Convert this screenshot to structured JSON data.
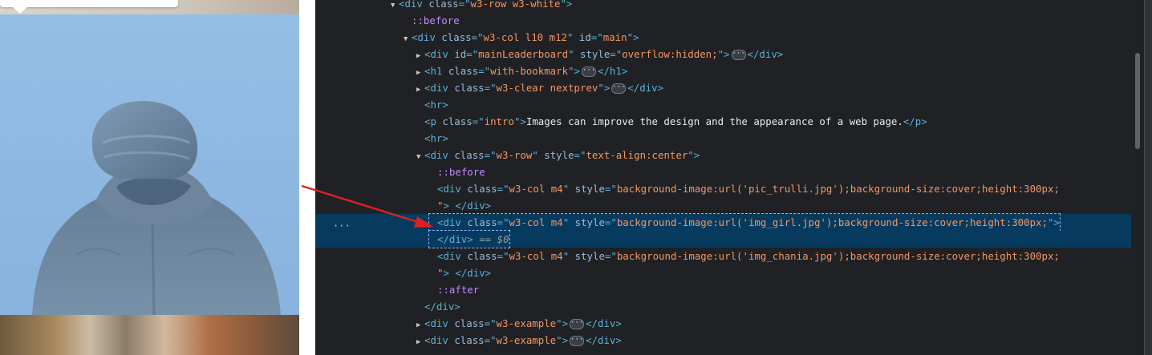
{
  "preview": {
    "images": [
      "pic_trulli.jpg",
      "img_girl.jpg",
      "img_chania.jpg"
    ]
  },
  "gutter": {
    "more_label": "···"
  },
  "elements_tree": [
    {
      "indent": 0,
      "tri": "open",
      "parts": [
        [
          "tag",
          "<div "
        ],
        [
          "attr",
          "class"
        ],
        [
          "tag",
          "=\""
        ],
        [
          "val",
          "w3-row w3-white"
        ],
        [
          "tag",
          "\">"
        ]
      ]
    },
    {
      "indent": 1,
      "tri": "",
      "parts": [
        [
          "pseudo",
          "::before"
        ]
      ]
    },
    {
      "indent": 1,
      "tri": "open",
      "parts": [
        [
          "tag",
          "<div "
        ],
        [
          "attr",
          "class"
        ],
        [
          "tag",
          "=\""
        ],
        [
          "val",
          "w3-col l10 m12"
        ],
        [
          "tag",
          "\" "
        ],
        [
          "attr",
          "id"
        ],
        [
          "tag",
          "=\""
        ],
        [
          "val",
          "main"
        ],
        [
          "tag",
          "\">"
        ]
      ]
    },
    {
      "indent": 2,
      "tri": "closed",
      "parts": [
        [
          "tag",
          "<div "
        ],
        [
          "attr",
          "id"
        ],
        [
          "tag",
          "=\""
        ],
        [
          "val",
          "mainLeaderboard"
        ],
        [
          "tag",
          "\" "
        ],
        [
          "attr",
          "style"
        ],
        [
          "tag",
          "=\""
        ],
        [
          "val",
          "overflow:hidden;"
        ],
        [
          "tag",
          "\">"
        ],
        [
          "ell",
          "···"
        ],
        [
          "tag",
          "</div>"
        ]
      ]
    },
    {
      "indent": 2,
      "tri": "closed",
      "parts": [
        [
          "tag",
          "<h1 "
        ],
        [
          "attr",
          "class"
        ],
        [
          "tag",
          "=\""
        ],
        [
          "val",
          "with-bookmark"
        ],
        [
          "tag",
          "\">"
        ],
        [
          "ell",
          "···"
        ],
        [
          "tag",
          "</h1>"
        ]
      ]
    },
    {
      "indent": 2,
      "tri": "closed",
      "parts": [
        [
          "tag",
          "<div "
        ],
        [
          "attr",
          "class"
        ],
        [
          "tag",
          "=\""
        ],
        [
          "val",
          "w3-clear nextprev"
        ],
        [
          "tag",
          "\">"
        ],
        [
          "ell",
          "···"
        ],
        [
          "tag",
          "</div>"
        ]
      ]
    },
    {
      "indent": 2,
      "tri": "",
      "parts": [
        [
          "tag",
          "<hr>"
        ]
      ]
    },
    {
      "indent": 2,
      "tri": "",
      "parts": [
        [
          "tag",
          "<p "
        ],
        [
          "attr",
          "class"
        ],
        [
          "tag",
          "=\""
        ],
        [
          "val",
          "intro"
        ],
        [
          "tag",
          "\">"
        ],
        [
          "text",
          "Images can improve the design and the appearance of a web page."
        ],
        [
          "tag",
          "</p>"
        ]
      ]
    },
    {
      "indent": 2,
      "tri": "",
      "parts": [
        [
          "tag",
          "<hr>"
        ]
      ]
    },
    {
      "indent": 2,
      "tri": "open",
      "parts": [
        [
          "tag",
          "<div "
        ],
        [
          "attr",
          "class"
        ],
        [
          "tag",
          "=\""
        ],
        [
          "val",
          "w3-row"
        ],
        [
          "tag",
          "\" "
        ],
        [
          "attr",
          "style"
        ],
        [
          "tag",
          "=\""
        ],
        [
          "val",
          "text-align:center"
        ],
        [
          "tag",
          "\">"
        ]
      ]
    },
    {
      "indent": 3,
      "tri": "",
      "parts": [
        [
          "pseudo",
          "::before"
        ]
      ]
    },
    {
      "indent": 3,
      "tri": "",
      "parts": [
        [
          "tag",
          "<div "
        ],
        [
          "attr",
          "class"
        ],
        [
          "tag",
          "=\""
        ],
        [
          "val",
          "w3-col m4"
        ],
        [
          "tag",
          "\" "
        ],
        [
          "attr",
          "style"
        ],
        [
          "tag",
          "=\""
        ],
        [
          "val",
          "background-image:url('pic_trulli.jpg');background-size:cover;height:300px;"
        ]
      ]
    },
    {
      "indent": 3,
      "tri": "",
      "parts": [
        [
          "val",
          "\""
        ],
        [
          "tag",
          "> </div>"
        ]
      ]
    },
    {
      "indent": 3,
      "tri": "",
      "selected": true,
      "parts": [
        [
          "tag",
          "<div "
        ],
        [
          "attr",
          "class"
        ],
        [
          "tag",
          "=\""
        ],
        [
          "val",
          "w3-col m4"
        ],
        [
          "tag",
          "\" "
        ],
        [
          "attr",
          "style"
        ],
        [
          "tag",
          "=\""
        ],
        [
          "val",
          "background-image:url('img_girl.jpg');background-size:cover;height:300px;"
        ],
        [
          "tag",
          "\">"
        ]
      ]
    },
    {
      "indent": 3,
      "tri": "",
      "selected": true,
      "parts": [
        [
          "tag",
          "</div>"
        ],
        [
          "dim",
          " == $0"
        ]
      ]
    },
    {
      "indent": 3,
      "tri": "",
      "parts": [
        [
          "tag",
          "<div "
        ],
        [
          "attr",
          "class"
        ],
        [
          "tag",
          "=\""
        ],
        [
          "val",
          "w3-col m4"
        ],
        [
          "tag",
          "\" "
        ],
        [
          "attr",
          "style"
        ],
        [
          "tag",
          "=\""
        ],
        [
          "val",
          "background-image:url('img_chania.jpg');background-size:cover;height:300px;"
        ]
      ]
    },
    {
      "indent": 3,
      "tri": "",
      "parts": [
        [
          "val",
          "\""
        ],
        [
          "tag",
          "> </div>"
        ]
      ]
    },
    {
      "indent": 3,
      "tri": "",
      "parts": [
        [
          "pseudo",
          "::after"
        ]
      ]
    },
    {
      "indent": 2,
      "tri": "",
      "parts": [
        [
          "tag",
          "</div>"
        ]
      ]
    },
    {
      "indent": 2,
      "tri": "closed",
      "parts": [
        [
          "tag",
          "<div "
        ],
        [
          "attr",
          "class"
        ],
        [
          "tag",
          "=\""
        ],
        [
          "val",
          "w3-example"
        ],
        [
          "tag",
          "\">"
        ],
        [
          "ell",
          "···"
        ],
        [
          "tag",
          "</div>"
        ]
      ]
    },
    {
      "indent": 2,
      "tri": "closed",
      "parts": [
        [
          "tag",
          "<div "
        ],
        [
          "attr",
          "class"
        ],
        [
          "tag",
          "=\""
        ],
        [
          "val",
          "w3-example"
        ],
        [
          "tag",
          "\">"
        ],
        [
          "ell",
          "···"
        ],
        [
          "tag",
          "</div>"
        ]
      ]
    }
  ],
  "colors": {
    "tag": "#5db0d7",
    "attribute": "#9bbbdc",
    "value": "#f29766",
    "pseudo": "#c58af9",
    "selection": "#063b5f",
    "arrow": "#e02020"
  }
}
